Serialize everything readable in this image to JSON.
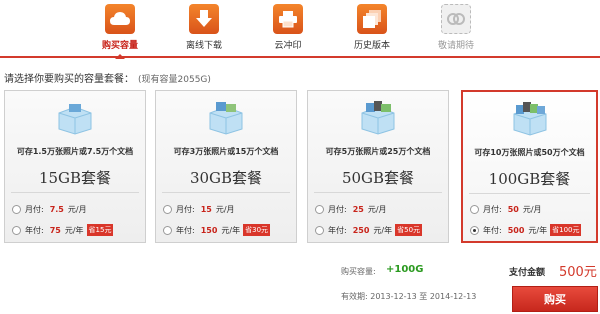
{
  "toolbar": {
    "items": [
      {
        "label": "购买容量",
        "icon": "cloud-icon",
        "state": "active"
      },
      {
        "label": "离线下载",
        "icon": "download-arrow-icon",
        "state": "normal"
      },
      {
        "label": "云冲印",
        "icon": "printer-icon",
        "state": "normal"
      },
      {
        "label": "历史版本",
        "icon": "stacked-files-icon",
        "state": "normal"
      },
      {
        "label": "敬请期待",
        "icon": "placeholder-icon",
        "state": "disabled"
      }
    ]
  },
  "prompt": {
    "text": "请选择你要购买的容量套餐：",
    "current": "(现有容量2055G)"
  },
  "packages": [
    {
      "desc": "可存1.5万张照片或7.5万个文档",
      "name": "15GB套餐",
      "monthly": {
        "label": "月付:",
        "price": "7.5",
        "unit": "元/月"
      },
      "yearly": {
        "label": "年付:",
        "price": "75",
        "unit": "元/年",
        "save": "省15元"
      },
      "selected": false
    },
    {
      "desc": "可存3万张照片或15万个文档",
      "name": "30GB套餐",
      "monthly": {
        "label": "月付:",
        "price": "15",
        "unit": "元/月"
      },
      "yearly": {
        "label": "年付:",
        "price": "150",
        "unit": "元/年",
        "save": "省30元"
      },
      "selected": false
    },
    {
      "desc": "可存5万张照片或25万个文档",
      "name": "50GB套餐",
      "monthly": {
        "label": "月付:",
        "price": "25",
        "unit": "元/月"
      },
      "yearly": {
        "label": "年付:",
        "price": "250",
        "unit": "元/年",
        "save": "省50元"
      },
      "selected": false
    },
    {
      "desc": "可存10万张照片或50万个文档",
      "name": "100GB套餐",
      "monthly": {
        "label": "月付:",
        "price": "50",
        "unit": "元/月"
      },
      "yearly": {
        "label": "年付:",
        "price": "500",
        "unit": "元/年",
        "save": "省100元"
      },
      "selected": true,
      "selected_option": "yearly"
    }
  ],
  "footer": {
    "added_label": "购买容量:",
    "added_value": "+100G",
    "validity_label": "有效期:",
    "validity_from": "2013-12-13",
    "validity_to_word": "至",
    "validity_to": "2014-12-13",
    "pay_label": "支付金额",
    "pay_amount": "500元",
    "buy_button": "购买"
  },
  "colors": {
    "accent": "#d33a2c",
    "price": "#c8241b",
    "added": "#2b9a20",
    "icon_orange": "#e8682a"
  }
}
